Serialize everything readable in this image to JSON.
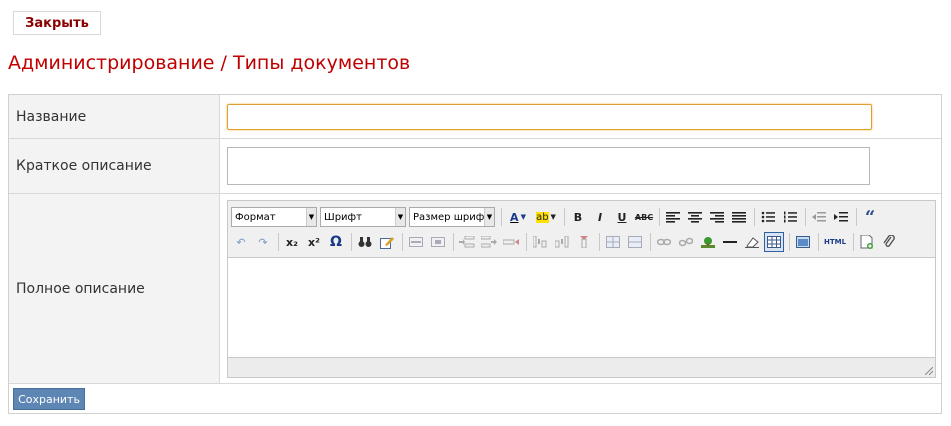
{
  "header": {
    "close_label": "Закрыть"
  },
  "page": {
    "title": "Администрирование / Типы документов"
  },
  "form": {
    "name": {
      "label": "Название",
      "value": ""
    },
    "short_desc": {
      "label": "Краткое описание",
      "value": ""
    },
    "full_desc": {
      "label": "Полное описание"
    },
    "save_label": "Сохранить"
  },
  "editor": {
    "format_select": "Формат",
    "font_select": "Шрифт",
    "size_select": "Размер шрифта",
    "icons": {
      "text_color": "font-color-icon",
      "bg_color": "highlight-color-icon",
      "bold": "bold-icon",
      "italic": "italic-icon",
      "underline": "underline-icon",
      "strike": "strikethrough-icon"
    },
    "button_glyphs": {
      "text_color": "A",
      "bg_color": "ab",
      "bold": "B",
      "italic": "I",
      "underline": "U",
      "strike": "ABC",
      "quote": "“",
      "subscript": "x₂",
      "superscript": "x²",
      "omega": "Ω",
      "html": "HTML"
    }
  },
  "colors": {
    "accent": "#c00000",
    "close_text": "#8b0000",
    "save_bg": "#5e86b4"
  }
}
